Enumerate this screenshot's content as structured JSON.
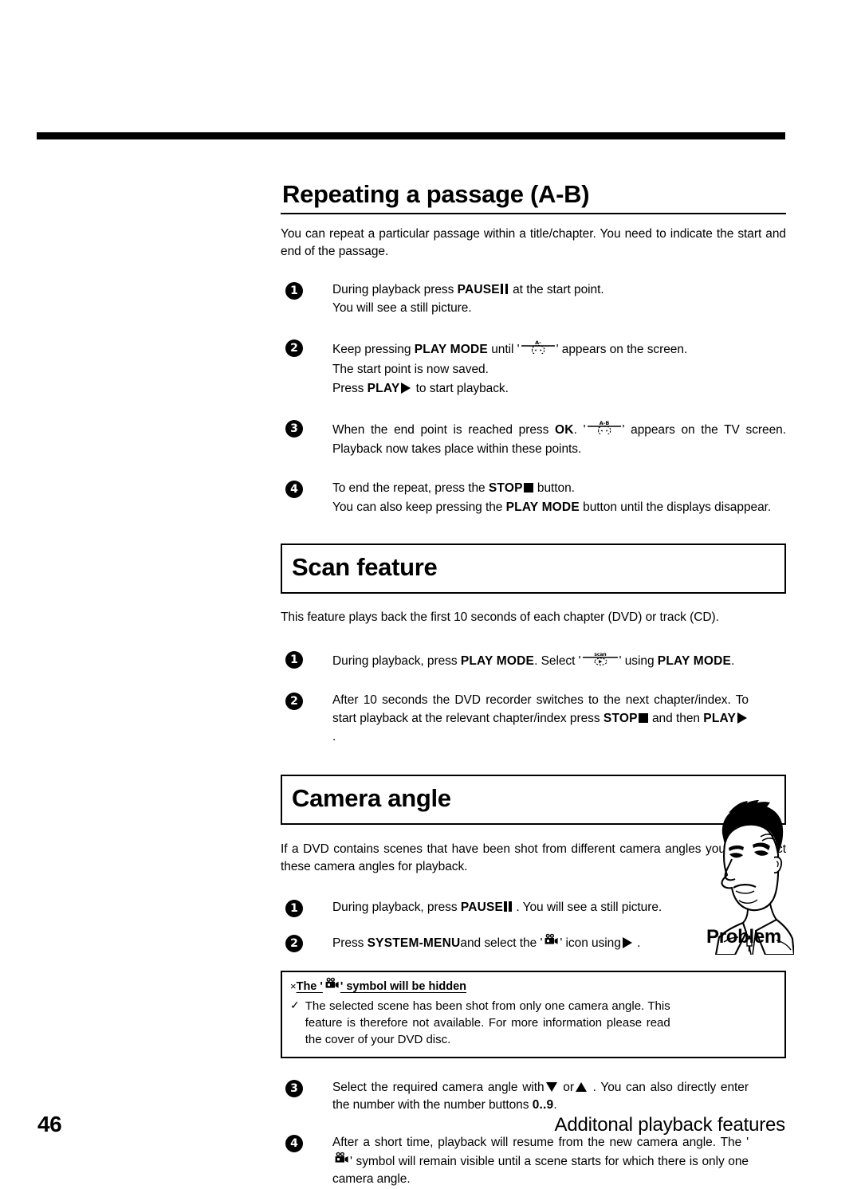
{
  "page": {
    "number": "46",
    "footer_title": "Additonal playback features"
  },
  "sections": [
    {
      "heading": "Repeating a passage (A-B)",
      "boxed": false,
      "intro": "You can repeat a particular passage within a title/chapter. You need to indicate the start and end of the passage.",
      "steps": [
        {
          "number": "1",
          "lines": [
            "During playback press PAUSE ⏸ at the start point.",
            "You will see a still picture."
          ]
        },
        {
          "number": "2",
          "lines": [
            "Keep pressing PLAY MODE until '[A- repeat icon]' appears on the screen.",
            "The start point is now saved.",
            "Press PLAY ▶ to start playback."
          ]
        },
        {
          "number": "3",
          "lines": [
            "When the end point is reached press OK . '[A-B repeat icon]' appears on the TV screen. Playback now takes place within these points."
          ]
        },
        {
          "number": "4",
          "lines": [
            "To end the repeat, press the STOP ■ button.",
            "You can also keep pressing the PLAY MODE button until the displays disappear."
          ]
        }
      ]
    },
    {
      "heading": "Scan feature",
      "boxed": true,
      "intro": "This feature plays back the first 10 seconds of each chapter (DVD) or track (CD).",
      "steps": [
        {
          "number": "1",
          "lines": [
            "During playback, press PLAY MODE . Select '[scan icon]' using PLAY MODE ."
          ]
        },
        {
          "number": "2",
          "lines": [
            "After 10 seconds the DVD recorder switches to the next chapter/index. To start playback at the relevant chapter/index press STOP ■ and then PLAY ▶ ."
          ]
        }
      ]
    },
    {
      "heading": "Camera angle",
      "boxed": true,
      "intro": "If a DVD contains scenes that have been shot from different camera angles you can select these camera angles for playback.",
      "steps": [
        {
          "number": "1",
          "lines": [
            "During playback, press PAUSE ⏸ . You will see a still picture."
          ]
        },
        {
          "number": "2",
          "lines": [
            "Press SYSTEM-MENU and select the '[camera icon]' icon using ▶ ."
          ]
        },
        {
          "number": "3",
          "lines": [
            "Select the required camera angle with ▼ or ▲ . You can also directly enter the number with the number buttons 0..9 ."
          ]
        },
        {
          "number": "4",
          "lines": [
            "After a short time, playback will resume from the new camera angle. The '[camera icon]' symbol will remain visible until a scene starts for which there is only one camera angle."
          ]
        }
      ]
    }
  ],
  "step_text": {
    "s1_1a": "During playback press",
    "s1_1b": "PAUSE",
    "s1_1c": "at the start point.",
    "s1_2": "You will see a still picture.",
    "s2_1a": "Keep pressing",
    "s2_1b": "PLAY MODE",
    "s2_1c": "until '",
    "s2_1d": "' appears on the screen.",
    "s2_2": "The start point is now saved.",
    "s2_3a": "Press",
    "s2_3b": "PLAY",
    "s2_3c": "to start playback.",
    "s3_1a": "When the end point is reached press",
    "s3_1b": "OK",
    "s3_1c": ". '",
    "s3_1d": "' appears on the TV screen. Playback now takes place within these points.",
    "s4_1a": "To end the repeat, press the",
    "s4_1b": "STOP",
    "s4_1c": "button.",
    "s4_2a": "You can also keep pressing the",
    "s4_2b": "PLAY MODE",
    "s4_2c": "button until the displays disappear.",
    "sc1_a": "During playback, press",
    "sc1_b": "PLAY MODE",
    "sc1_c": ". Select '",
    "sc1_d": "' using",
    "sc1_e": "PLAY MODE",
    "sc1_f": ".",
    "sc2_a": "After 10 seconds the DVD recorder switches to the next chapter/index. To start playback at the relevant chapter/index press",
    "sc2_b": "STOP",
    "sc2_c": "and then",
    "sc2_d": "PLAY",
    "sc2_e": ".",
    "ca1_a": "During playback, press",
    "ca1_b": "PAUSE",
    "ca1_c": ". You will see a still picture.",
    "ca2_a": "Press",
    "ca2_b": "SYSTEM-MENU",
    "ca2_c": "and select the '",
    "ca2_d": "' icon using",
    "ca2_e": ".",
    "ca3_a": "Select the required camera angle with",
    "ca3_b": "or",
    "ca3_c": ". You can also directly enter the number with the number buttons",
    "ca3_d": "0..9",
    "ca3_e": ".",
    "ca4_a": "After a short time, playback will resume from the new camera angle. The '",
    "ca4_b": "' symbol will remain visible until a scene starts for which there is only one camera angle."
  },
  "tip": {
    "cross": "×",
    "check": "✓",
    "head_a": "The '",
    "head_b": "' symbol will be hidden",
    "body": "The selected scene has been shot from only one camera angle. This feature is therefore not available. For more information please read the cover of your DVD disc.",
    "label": "Problem"
  },
  "icons": {
    "ab_repeat_start": "A-",
    "ab_repeat_full": "A-B",
    "scan_label": "scan",
    "camera": "camera-angle-icon"
  },
  "colors": {
    "ink": "#000000",
    "paper": "#ffffff"
  }
}
